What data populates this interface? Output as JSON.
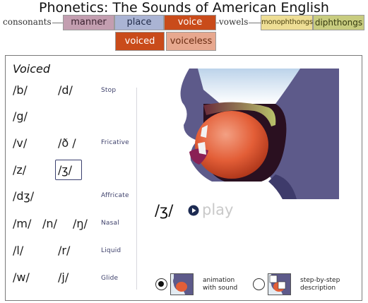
{
  "title": "Phonetics:  The Sounds of American English",
  "nav": {
    "consonants_label": "consonants",
    "vowels_label": "vowels",
    "manner": "manner",
    "place": "place",
    "voice": "voice",
    "voiced": "voiced",
    "voiceless": "voiceless",
    "monophthongs": "monophthongs",
    "diphthongs": "diphthongs"
  },
  "panel": {
    "heading": "Voiced",
    "rows": [
      {
        "symbols": [
          "/b/",
          "/d/"
        ],
        "category": "Stop"
      },
      {
        "symbols": [
          "/g/"
        ],
        "category": ""
      },
      {
        "symbols": [
          "/v/",
          "/ð /"
        ],
        "category": "Fricative"
      },
      {
        "symbols": [
          "/z/",
          "/ʒ/"
        ],
        "category": ""
      },
      {
        "symbols": [
          "/dʒ/"
        ],
        "category": "Affricate"
      },
      {
        "symbols": [
          "/m/",
          "/n/",
          "/ŋ/"
        ],
        "category": "Nasal"
      },
      {
        "symbols": [
          "/l/",
          "/r/"
        ],
        "category": "Liquid"
      },
      {
        "symbols": [
          "/w/",
          "/j/"
        ],
        "category": "Glide"
      }
    ],
    "selected_symbol": "/ʒ/",
    "current_symbol": "/ʒ/",
    "play_label": "play"
  },
  "options": {
    "animation_line1": "animation",
    "animation_line2": "with sound",
    "step_line1": "step-by-step",
    "step_line2": "description",
    "selected": "animation"
  },
  "colors": {
    "voice_active": "#c94b1a",
    "manner": "#c39eb0",
    "place": "#aab4d4",
    "voiceless": "#e7a88f",
    "monophthongs": "#eede95",
    "diphthongs": "#c8cc7f",
    "category_text": "#3c3f6a"
  }
}
